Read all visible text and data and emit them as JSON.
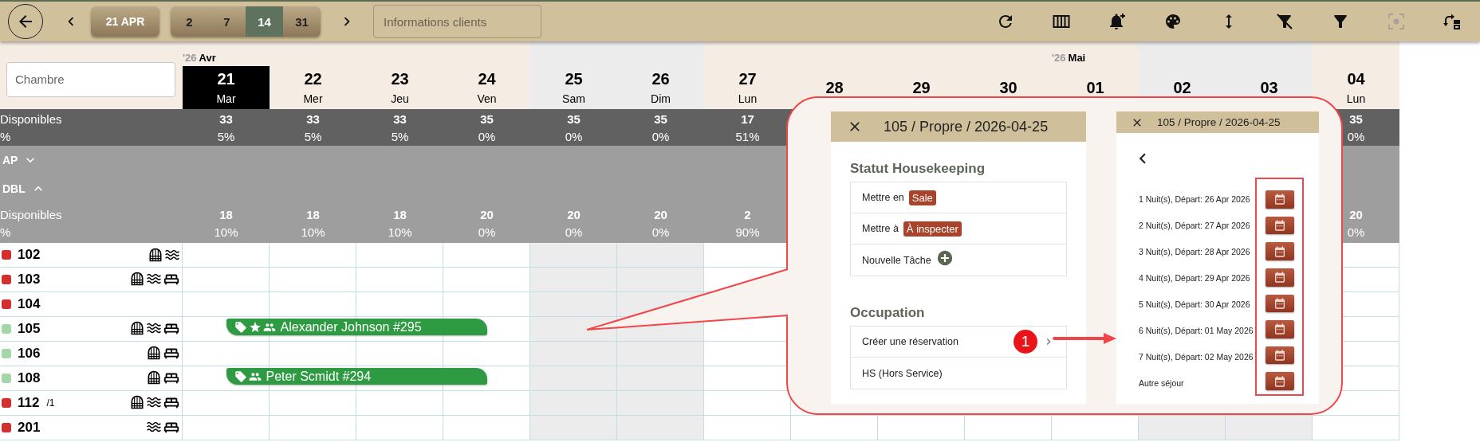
{
  "toolbar": {
    "date_button": "21 APR",
    "ranges": [
      {
        "label": "2",
        "selected": false
      },
      {
        "label": "7",
        "selected": false
      },
      {
        "label": "14",
        "selected": true
      },
      {
        "label": "31",
        "selected": false
      }
    ],
    "search": {
      "placeholder": "Informations clients"
    },
    "actions": [
      {
        "kind": "refresh",
        "disabled": false
      },
      {
        "kind": "columns",
        "disabled": false
      },
      {
        "kind": "bell-plus",
        "disabled": false
      },
      {
        "kind": "palette",
        "disabled": false
      },
      {
        "kind": "height",
        "disabled": false
      },
      {
        "kind": "filter-off",
        "disabled": false
      },
      {
        "kind": "filter",
        "disabled": false
      },
      {
        "kind": "focus",
        "disabled": true
      },
      {
        "kind": "swap",
        "disabled": false
      }
    ]
  },
  "room_filter": {
    "placeholder": "Chambre"
  },
  "totals": {
    "label": "Disponibles",
    "percent_label": "%"
  },
  "days": [
    {
      "number": "21",
      "name": "Mar",
      "weekend": false,
      "selected": true,
      "month": {
        "year": "'26",
        "name": "Avr"
      },
      "available": {
        "count": "33",
        "percent": "5%"
      },
      "group_available": {
        "count": "18",
        "percent": "10%"
      }
    },
    {
      "number": "22",
      "name": "Mer",
      "weekend": false,
      "selected": false,
      "available": {
        "count": "33",
        "percent": "5%"
      },
      "group_available": {
        "count": "18",
        "percent": "10%"
      }
    },
    {
      "number": "23",
      "name": "Jeu",
      "weekend": false,
      "selected": false,
      "available": {
        "count": "33",
        "percent": "5%"
      },
      "group_available": {
        "count": "18",
        "percent": "10%"
      }
    },
    {
      "number": "24",
      "name": "Ven",
      "weekend": false,
      "selected": false,
      "available": {
        "count": "35",
        "percent": "0%"
      },
      "group_available": {
        "count": "20",
        "percent": "0%"
      }
    },
    {
      "number": "25",
      "name": "Sam",
      "weekend": true,
      "selected": false,
      "available": {
        "count": "35",
        "percent": "0%"
      },
      "group_available": {
        "count": "20",
        "percent": "0%"
      }
    },
    {
      "number": "26",
      "name": "Dim",
      "weekend": true,
      "selected": false,
      "available": {
        "count": "35",
        "percent": "0%"
      },
      "group_available": {
        "count": "20",
        "percent": "0%"
      }
    },
    {
      "number": "27",
      "name": "Lun",
      "weekend": false,
      "selected": false,
      "available": {
        "count": "17",
        "percent": "51%"
      },
      "group_available": {
        "count": "2",
        "percent": "90%"
      }
    },
    {
      "number": "28",
      "weekend": false,
      "selected": false
    },
    {
      "number": "29",
      "weekend": false,
      "selected": false
    },
    {
      "number": "30",
      "weekend": false,
      "selected": false
    },
    {
      "number": "01",
      "weekend": false,
      "selected": false,
      "month": {
        "year": "'26",
        "name": "Mai"
      }
    },
    {
      "number": "02",
      "weekend": true,
      "selected": false
    },
    {
      "number": "03",
      "weekend": true,
      "selected": false
    },
    {
      "number": "04",
      "name": "Lun",
      "weekend": false,
      "selected": false,
      "available": {
        "count": "35",
        "percent": "0%"
      },
      "group_available": {
        "count": "20",
        "percent": "0%"
      }
    }
  ],
  "groups": [
    {
      "name": "AP",
      "expanded": false
    },
    {
      "name": "DBL",
      "expanded": true,
      "label": "Disponibles",
      "percent_label": "%"
    }
  ],
  "rooms": [
    {
      "number": "102",
      "color": "#d32f2f",
      "window": true,
      "sea": true,
      "bed": false
    },
    {
      "number": "103",
      "color": "#d32f2f",
      "window": true,
      "sea": true,
      "bed": true
    },
    {
      "number": "104",
      "color": "#d32f2f",
      "window": false,
      "sea": false,
      "bed": false
    },
    {
      "number": "105",
      "color": "#a5d6a7",
      "window": true,
      "sea": true,
      "bed": true,
      "booking": {
        "guest": "Alexander Johnson #295",
        "tag": true,
        "star": true,
        "group": true,
        "occupied": [
          true,
          true,
          true,
          true,
          false,
          false,
          false,
          false,
          false,
          false,
          false,
          false,
          false,
          false
        ]
      }
    },
    {
      "number": "106",
      "color": "#a5d6a7",
      "window": true,
      "sea": false,
      "bed": true
    },
    {
      "number": "108",
      "color": "#a5d6a7",
      "window": true,
      "sea": false,
      "bed": true,
      "booking": {
        "guest": "Peter Scmidt #294",
        "tag": true,
        "star": false,
        "group": true,
        "occupied": [
          true,
          true,
          true,
          true,
          false,
          false,
          false,
          false,
          false,
          false,
          false,
          false,
          false,
          false
        ]
      }
    },
    {
      "number": "112",
      "suffix": "/1",
      "color": "#d32f2f",
      "window": true,
      "sea": true,
      "bed": true
    },
    {
      "number": "201",
      "color": "#d32f2f",
      "window": false,
      "sea": true,
      "bed": true
    }
  ],
  "room_menu": {
    "title": "105 / Propre / 2026-04-25",
    "sections": [
      {
        "title": "Statut Housekeeping",
        "items": [
          {
            "kind": "status",
            "text": "Mettre en",
            "badge": "Sale"
          },
          {
            "kind": "status",
            "text": "Mettre à",
            "badge": "À inspecter"
          },
          {
            "kind": "add",
            "text": "Nouvelle Tâche"
          }
        ]
      },
      {
        "title": "Occupation",
        "items": [
          {
            "kind": "submenu",
            "text": "Créer une réservation",
            "step": "1"
          },
          {
            "kind": "plain",
            "text": "HS (Hors Service)"
          }
        ]
      }
    ]
  },
  "stay_menu": {
    "title": "105 / Propre / 2026-04-25",
    "options": [
      "1 Nuit(s), Départ: 26 Apr 2026",
      "2 Nuit(s), Départ: 27 Apr 2026",
      "3 Nuit(s), Départ: 28 Apr 2026",
      "4 Nuit(s), Départ: 29 Apr 2026",
      "5 Nuit(s), Départ: 30 Apr 2026",
      "6 Nuit(s), Départ: 01 May 2026",
      "7 Nuit(s), Départ: 02 May 2026",
      "Autre séjour"
    ]
  }
}
